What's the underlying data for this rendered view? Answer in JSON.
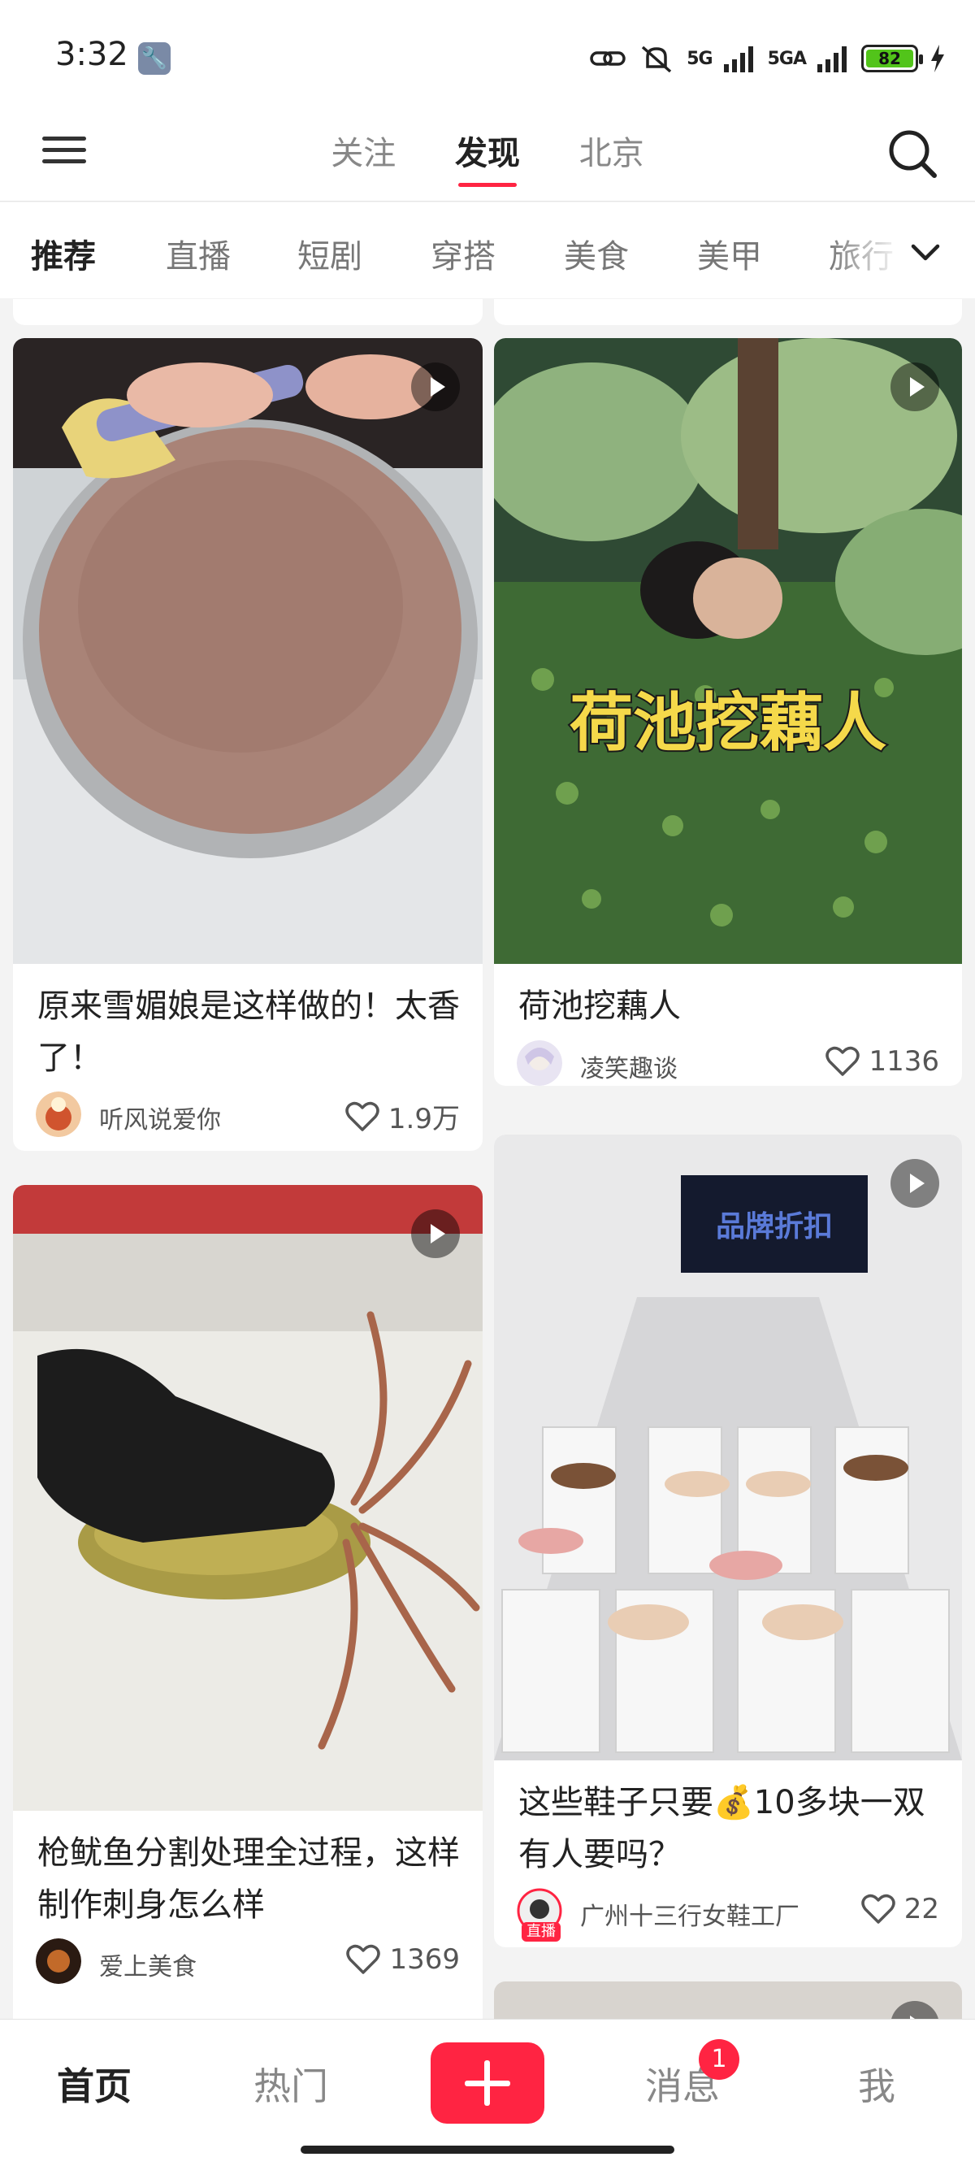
{
  "status_bar": {
    "time": "3:32",
    "signal_1": "5G",
    "signal_2": "5GA",
    "battery_level": "82"
  },
  "top_nav": {
    "tabs": [
      {
        "label": "关注",
        "active": false
      },
      {
        "label": "发现",
        "active": true
      },
      {
        "label": "北京",
        "active": false
      }
    ]
  },
  "categories": [
    {
      "label": "推荐",
      "active": true
    },
    {
      "label": "直播",
      "active": false
    },
    {
      "label": "短剧",
      "active": false
    },
    {
      "label": "穿搭",
      "active": false
    },
    {
      "label": "美食",
      "active": false
    },
    {
      "label": "美甲",
      "active": false
    },
    {
      "label": "旅行",
      "active": false
    }
  ],
  "feed": {
    "cards": [
      {
        "title": "原来雪媚娘是这样做的！太香了！",
        "author": "听风说爱你",
        "likes": "1.9万",
        "video": true
      },
      {
        "title": "荷池挖藕人",
        "image_caption": "荷池挖藕人",
        "author": "凌笑趣谈",
        "likes": "1136",
        "video": true
      },
      {
        "title": "枪鱿鱼分割处理全过程，这样制作刺身怎么样",
        "author": "爱上美食",
        "likes": "1369",
        "video": true
      },
      {
        "title": "这些鞋子只要💰10多块一双有人要吗？",
        "image_caption": "品牌折扣",
        "author": "广州十三行女鞋工厂",
        "live_tag": "直播",
        "likes": "22",
        "video": true
      }
    ]
  },
  "bottom_nav": {
    "items": [
      {
        "label": "首页",
        "active": true
      },
      {
        "label": "热门",
        "active": false
      },
      {
        "label": "消息",
        "active": false
      },
      {
        "label": "我",
        "active": false
      }
    ],
    "message_badge": "1"
  },
  "colors": {
    "accent": "#ff2442",
    "background": "#f3f3f3"
  },
  "icons": [
    "menu-icon",
    "search-icon",
    "chevron-down-icon",
    "play-icon",
    "heart-icon",
    "plus-icon",
    "wrench-icon",
    "link-icon",
    "mute-icon",
    "battery-icon",
    "charging-icon"
  ]
}
